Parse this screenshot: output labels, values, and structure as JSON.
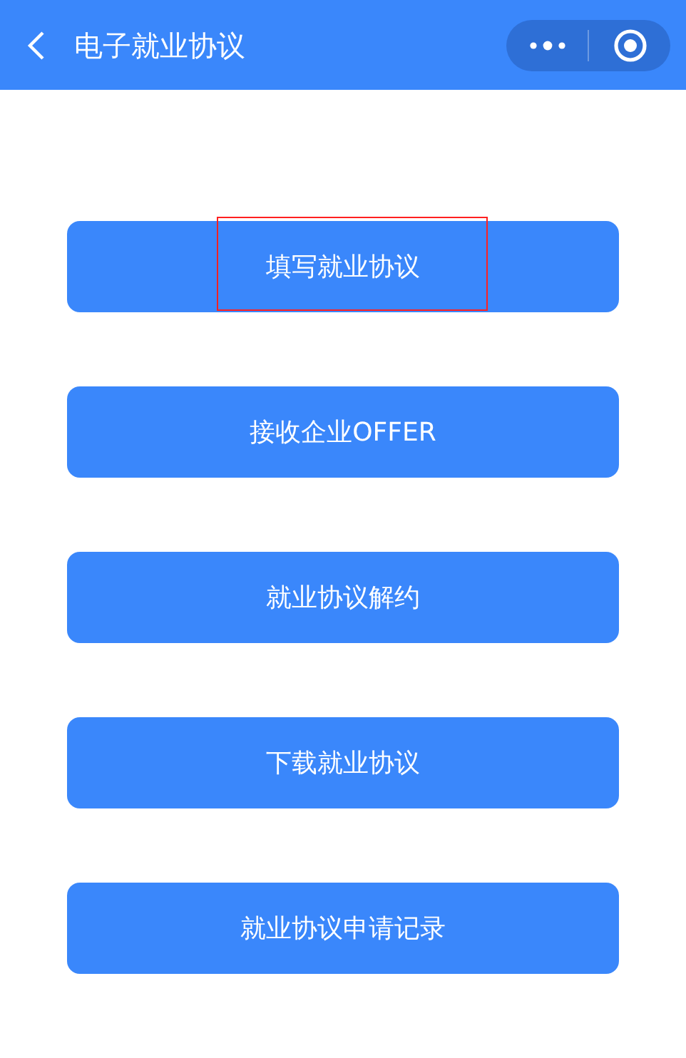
{
  "header": {
    "title": "电子就业协议"
  },
  "buttons": [
    {
      "label": "填写就业协议",
      "highlighted": true
    },
    {
      "label": "接收企业OFFER",
      "highlighted": false
    },
    {
      "label": "就业协议解约",
      "highlighted": false
    },
    {
      "label": "下载就业协议",
      "highlighted": false
    },
    {
      "label": "就业协议申请记录",
      "highlighted": false
    }
  ]
}
